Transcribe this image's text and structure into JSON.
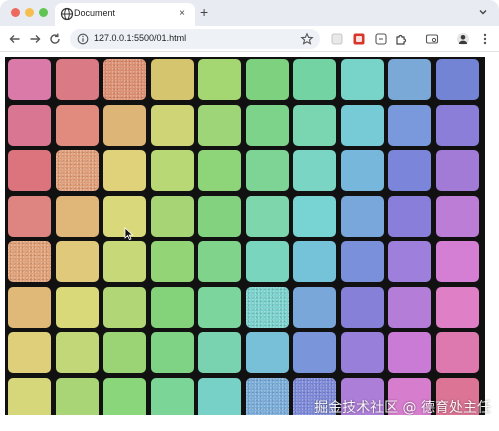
{
  "browser": {
    "tab_title": "Document",
    "tab_close_glyph": "×",
    "new_tab_glyph": "+",
    "url": "127.0.0.1:5500/01.html"
  },
  "icons": {
    "back": "arrow-left-icon",
    "forward": "arrow-right-icon",
    "reload": "reload-icon",
    "info": "info-icon",
    "bookmark": "star-icon",
    "extensions": "puzzle-icon"
  },
  "page": {
    "background": "#111111",
    "columns": 10,
    "rows": 8,
    "cells": [
      [
        "#d97aa8",
        "#d97a84",
        "#dd8f72",
        "#d4c56e",
        "#a4d671",
        "#7dd17f",
        "#74d3a3",
        "#78d3c9",
        "#7aa8d7",
        "#7484d5"
      ],
      [
        "#d97692",
        "#e08b7d",
        "#ddb576",
        "#cfd476",
        "#9fd579",
        "#7dd389",
        "#7ad5b1",
        "#76cbd6",
        "#7a99dc",
        "#8a7ed9"
      ],
      [
        "#dc747d",
        "#e09e78",
        "#dfd27b",
        "#b8d775",
        "#8ed57a",
        "#7dd495",
        "#7ad5c5",
        "#76b7db",
        "#7b86db",
        "#a27bd6"
      ],
      [
        "#df8581",
        "#e0b679",
        "#d9d87b",
        "#a7d576",
        "#83d27f",
        "#7ed6ad",
        "#78d3d3",
        "#79a6db",
        "#8a7edb",
        "#bb7dd6"
      ],
      [
        "#e0a077",
        "#e1c97c",
        "#c7d878",
        "#93d477",
        "#7fd38a",
        "#79d5bd",
        "#74c3d9",
        "#7a90da",
        "#9f7fdc",
        "#d47fd4"
      ],
      [
        "#e0b878",
        "#d9d97a",
        "#b1d676",
        "#84d27a",
        "#7cd59c",
        "#7ad1cd",
        "#7aa7da",
        "#8680d8",
        "#b47ed8",
        "#df7fc6"
      ],
      [
        "#dfcf7a",
        "#c2d878",
        "#9bd475",
        "#7ed384",
        "#79d3b1",
        "#78bfd8",
        "#7b95da",
        "#987fd9",
        "#c97bd6",
        "#de79b0"
      ],
      [
        "#d6d67a",
        "#a9d577",
        "#8ad67a",
        "#7ad596",
        "#78d1c6",
        "#79acd8",
        "#7c88d8",
        "#ad7ed8",
        "#d77dce",
        "#dc7496"
      ]
    ],
    "noisy_cells": [
      [
        0,
        2
      ],
      [
        2,
        1
      ],
      [
        4,
        0
      ],
      [
        5,
        5
      ],
      [
        7,
        5
      ],
      [
        7,
        6
      ]
    ],
    "watermark": "掘金技术社区 @ 德育处主任"
  }
}
